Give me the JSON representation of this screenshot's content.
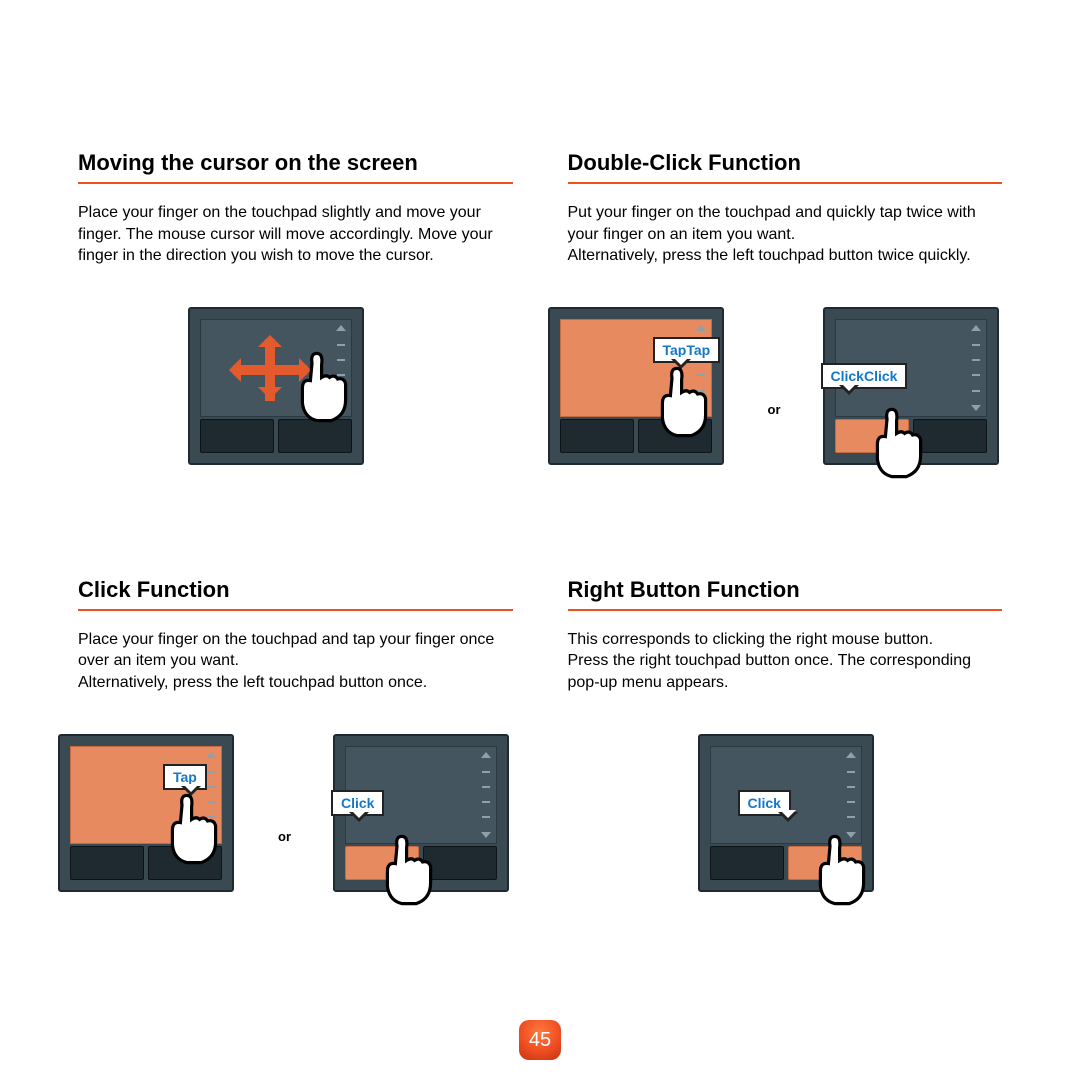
{
  "page_number": "45",
  "sections": {
    "s1": {
      "title": "Moving the cursor on the screen",
      "body": "Place your finger on the touchpad slightly and move your finger. The mouse cursor will move accordingly. Move your finger in the direction you wish to move the cursor."
    },
    "s2": {
      "title": "Double-Click Function",
      "body": "Put your finger on the touchpad and quickly tap twice with your finger on an item you want.\nAlternatively, press the left touchpad button twice quickly.",
      "label_tap": "TapTap",
      "label_click": "ClickClick",
      "or": "or"
    },
    "s3": {
      "title": "Click Function",
      "body": "Place your finger on the touchpad and tap your finger once over an item you want.\nAlternatively, press the left touchpad button once.",
      "label_tap": "Tap",
      "label_click": "Click",
      "or": "or"
    },
    "s4": {
      "title": "Right Button Function",
      "body": "This corresponds to clicking the right mouse button.\nPress the right touchpad button once. The corresponding pop-up menu appears.",
      "label_click": "Click"
    }
  }
}
